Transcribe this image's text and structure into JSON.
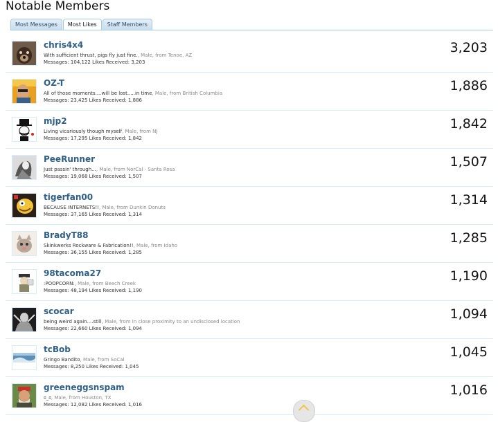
{
  "page": {
    "title": "Notable Members"
  },
  "tabs": [
    {
      "label": "Most Messages",
      "active": false
    },
    {
      "label": "Most Likes",
      "active": true
    },
    {
      "label": "Staff Members",
      "active": false
    }
  ],
  "members": [
    {
      "username": "chris4x4",
      "title": "With sufficient thrust, pigs fly just fine.",
      "gender": "Male",
      "location": "Tenoe, AZ",
      "messages": "104,122",
      "likes": "3,203",
      "count": "3,203"
    },
    {
      "username": "OZ-T",
      "title": "All of those moments....will be lost.....in time",
      "gender": "Male",
      "location": "British Columbia",
      "messages": "23,425",
      "likes": "1,886",
      "count": "1,886"
    },
    {
      "username": "mjp2",
      "title": "Living vicariously though myself",
      "gender": "Male",
      "location": "NJ",
      "messages": "17,295",
      "likes": "1,842",
      "count": "1,842"
    },
    {
      "username": "PeeRunner",
      "title": "Just passin' through...",
      "gender": "Male",
      "location": "NorCal - Santa Rosa",
      "messages": "19,068",
      "likes": "1,507",
      "count": "1,507"
    },
    {
      "username": "tigerfan00",
      "title": "BECAUSE INTERNETS!!",
      "gender": "Male",
      "location": "Dunkin Donuts",
      "messages": "37,165",
      "likes": "1,314",
      "count": "1,314"
    },
    {
      "username": "BradyT88",
      "title": "Skinkwerks Rockware & Fabrication!!",
      "gender": "Male",
      "location": "Idaho",
      "messages": "36,155",
      "likes": "1,285",
      "count": "1,285"
    },
    {
      "username": "98tacoma27",
      "title": ":POOPCORN:",
      "gender": "Male",
      "location": "Beech Creek",
      "messages": "48,194",
      "likes": "1,190",
      "count": "1,190"
    },
    {
      "username": "scocar",
      "title": "being weird again....still",
      "gender": "Male",
      "location": "In close proximity to an undisclosed location",
      "messages": "22,660",
      "likes": "1,094",
      "count": "1,094"
    },
    {
      "username": "tcBob",
      "title": "Gringo Bandito",
      "gender": "Male",
      "location": "SoCal",
      "messages": "8,250",
      "likes": "1,045",
      "count": "1,045"
    },
    {
      "username": "greeneggsnspam",
      "title": "ಠ_ಠ",
      "gender": "Male",
      "location": "Houston, TX",
      "messages": "12,082",
      "likes": "1,016",
      "count": "1,016"
    }
  ],
  "labels": {
    "from": "from",
    "messages": "Messages:",
    "likes_received": "Likes Received:",
    "separator": ", "
  },
  "colors": {
    "link": "#2f5f86",
    "tab_border": "#a5cae4",
    "row_border": "#d7edfc"
  }
}
